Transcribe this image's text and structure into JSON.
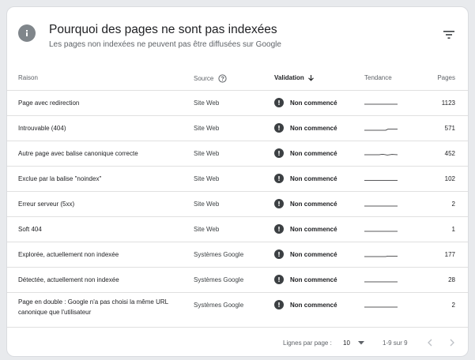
{
  "header": {
    "title": "Pourquoi des pages ne sont pas indexées",
    "subtitle": "Les pages non indexées ne peuvent pas être diffusées sur Google"
  },
  "columns": {
    "reason": "Raison",
    "source": "Source",
    "validation": "Validation",
    "trend": "Tendance",
    "pages": "Pages"
  },
  "rows": [
    {
      "reason": "Page avec redirection",
      "source": "Site Web",
      "validation": "Non commencé",
      "pages": "1123"
    },
    {
      "reason": "Introuvable (404)",
      "source": "Site Web",
      "validation": "Non commencé",
      "pages": "571"
    },
    {
      "reason": "Autre page avec balise canonique correcte",
      "source": "Site Web",
      "validation": "Non commencé",
      "pages": "452"
    },
    {
      "reason": "Exclue par la balise \"noindex\"",
      "source": "Site Web",
      "validation": "Non commencé",
      "pages": "102"
    },
    {
      "reason": "Erreur serveur (5xx)",
      "source": "Site Web",
      "validation": "Non commencé",
      "pages": "2"
    },
    {
      "reason": "Soft 404",
      "source": "Site Web",
      "validation": "Non commencé",
      "pages": "1"
    },
    {
      "reason": "Explorée, actuellement non indexée",
      "source": "Systèmes Google",
      "validation": "Non commencé",
      "pages": "177"
    },
    {
      "reason": "Détectée, actuellement non indexée",
      "source": "Systèmes Google",
      "validation": "Non commencé",
      "pages": "28"
    },
    {
      "reason": "Page en double : Google n'a pas choisi la même URL canonique que l'utilisateur",
      "source": "Systèmes Google",
      "validation": "Non commencé",
      "pages": "2"
    }
  ],
  "footer": {
    "rows_per_page_label": "Lignes par page :",
    "rows_per_page_value": "10",
    "range": "1-9 sur 9"
  },
  "icons": {
    "header": "info-icon",
    "filter": "filter-icon",
    "help": "help-circle-icon",
    "sort": "arrow-down-icon",
    "status": "exclamation-icon",
    "prev": "chevron-left-icon",
    "next": "chevron-right-icon"
  },
  "colors": {
    "status_icon": "#3c4043",
    "divider": "#e0e0e0",
    "muted_text": "#5f6368"
  }
}
